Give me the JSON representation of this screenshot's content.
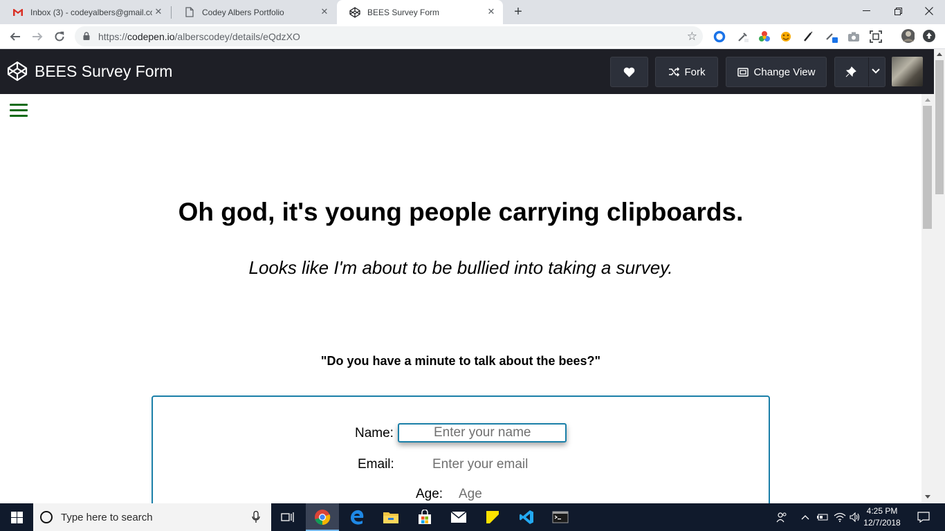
{
  "browser": {
    "tabs": [
      {
        "title": "Inbox (3) - codeyalbers@gmail.co",
        "icon": "gmail-icon"
      },
      {
        "title": "Codey Albers Portfolio",
        "icon": "document-icon"
      },
      {
        "title": "BEES Survey Form",
        "icon": "codepen-icon",
        "active": true
      }
    ],
    "url_prefix": "https://",
    "url_host": "codepen.io",
    "url_path": "/alberscodey/details/eQdzXO"
  },
  "codepen": {
    "title": "BEES Survey Form",
    "fork_label": "Fork",
    "change_view_label": "Change View"
  },
  "page": {
    "heading": "Oh god, it's young people carrying clipboards.",
    "subheading": "Looks like I'm about to be bullied into taking a survey.",
    "question": "\"Do you have a minute to talk about the bees?\"",
    "form": {
      "name_label": "Name:",
      "name_placeholder": "Enter your name",
      "email_label": "Email:",
      "email_placeholder": "Enter your email",
      "age_label": "Age:",
      "age_placeholder": "Age"
    },
    "accent_color": "#1a7fa8",
    "hamburger_color": "#0f6b16"
  },
  "taskbar": {
    "search_placeholder": "Type here to search",
    "time": "4:25 PM",
    "date": "12/7/2018"
  }
}
